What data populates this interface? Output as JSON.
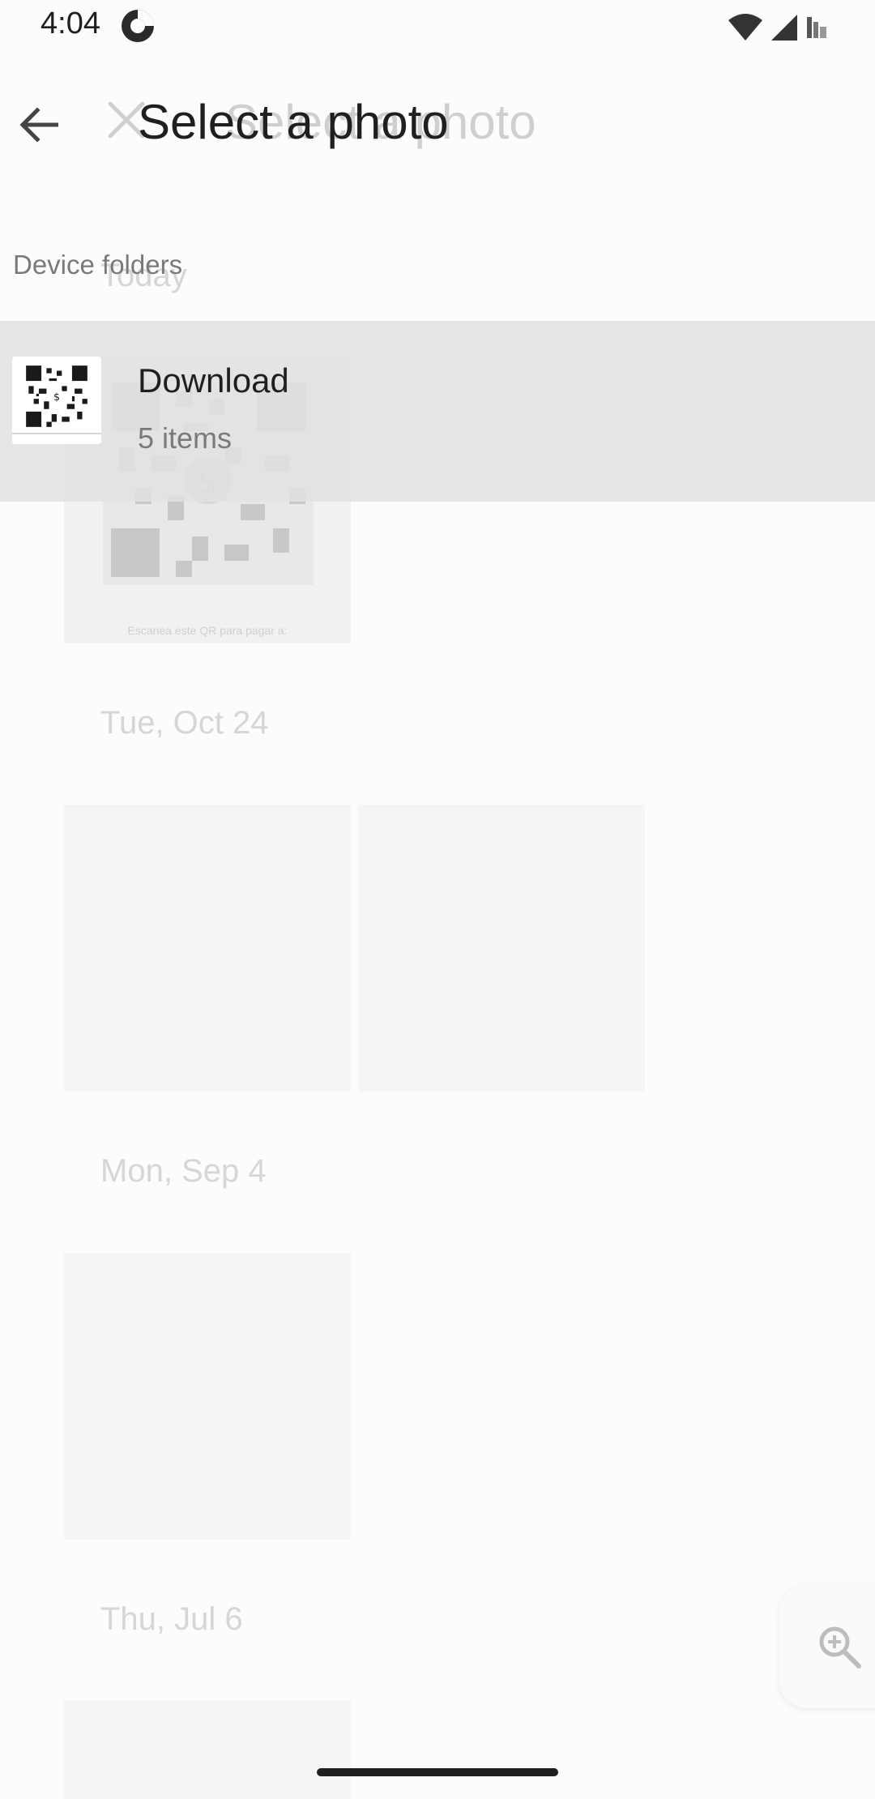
{
  "status_bar": {
    "time": "4:04",
    "icons": [
      "app-badge-icon",
      "wifi-icon",
      "signal-icon",
      "signal-icon-2"
    ]
  },
  "background_page": {
    "title": "Select a photo",
    "sections": [
      {
        "label": "Today"
      },
      {
        "label": "Tue, Oct 24"
      },
      {
        "label": "Mon, Sep 4"
      },
      {
        "label": "Thu, Jul 6"
      }
    ],
    "qr_caption": "Escanea este QR para pagar a:"
  },
  "header": {
    "title": "Select a photo"
  },
  "device_folders": {
    "label": "Device folders",
    "folders": [
      {
        "name": "Download",
        "count": "5 items"
      }
    ]
  },
  "colors": {
    "text_primary": "#1f1f1f",
    "text_secondary": "#7a7a7a",
    "ghost_text": "#d6d6d6",
    "highlight_row": "#e2e2e2"
  }
}
